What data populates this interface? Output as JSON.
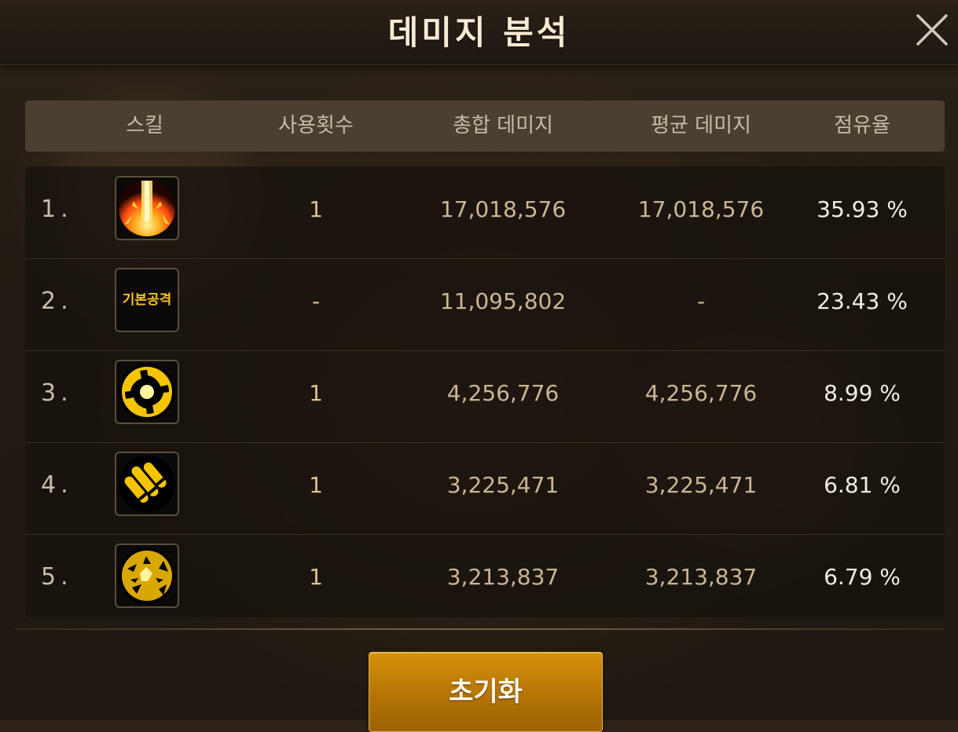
{
  "dialog": {
    "title": "데미지 분석",
    "close_icon": "close-icon"
  },
  "table": {
    "headers": {
      "skill": "스킬",
      "uses": "사용횟수",
      "total_damage": "총합 데미지",
      "avg_damage": "평균 데미지",
      "share": "점유율"
    },
    "rows": [
      {
        "rank": "1.",
        "icon": "explosion-skill-icon",
        "uses": "1",
        "total": "17,018,576",
        "avg": "17,018,576",
        "share": "35.93 %"
      },
      {
        "rank": "2.",
        "icon": "basic-attack-icon",
        "icon_text": "기본공격",
        "uses": "-",
        "total": "11,095,802",
        "avg": "-",
        "share": "23.43 %"
      },
      {
        "rank": "3.",
        "icon": "vortex-skill-icon",
        "uses": "1",
        "total": "4,256,776",
        "avg": "4,256,776",
        "share": "8.99 %"
      },
      {
        "rank": "4.",
        "icon": "bullets-skill-icon",
        "uses": "1",
        "total": "3,225,471",
        "avg": "3,225,471",
        "share": "6.81 %"
      },
      {
        "rank": "5.",
        "icon": "burst-skill-icon",
        "uses": "1",
        "total": "3,213,837",
        "avg": "3,213,837",
        "share": "6.79 %"
      }
    ]
  },
  "footer": {
    "reset_label": "초기화"
  },
  "colors": {
    "accent": "#f7c21a",
    "button": "#b57406",
    "header_bar": "#4a3f31"
  }
}
